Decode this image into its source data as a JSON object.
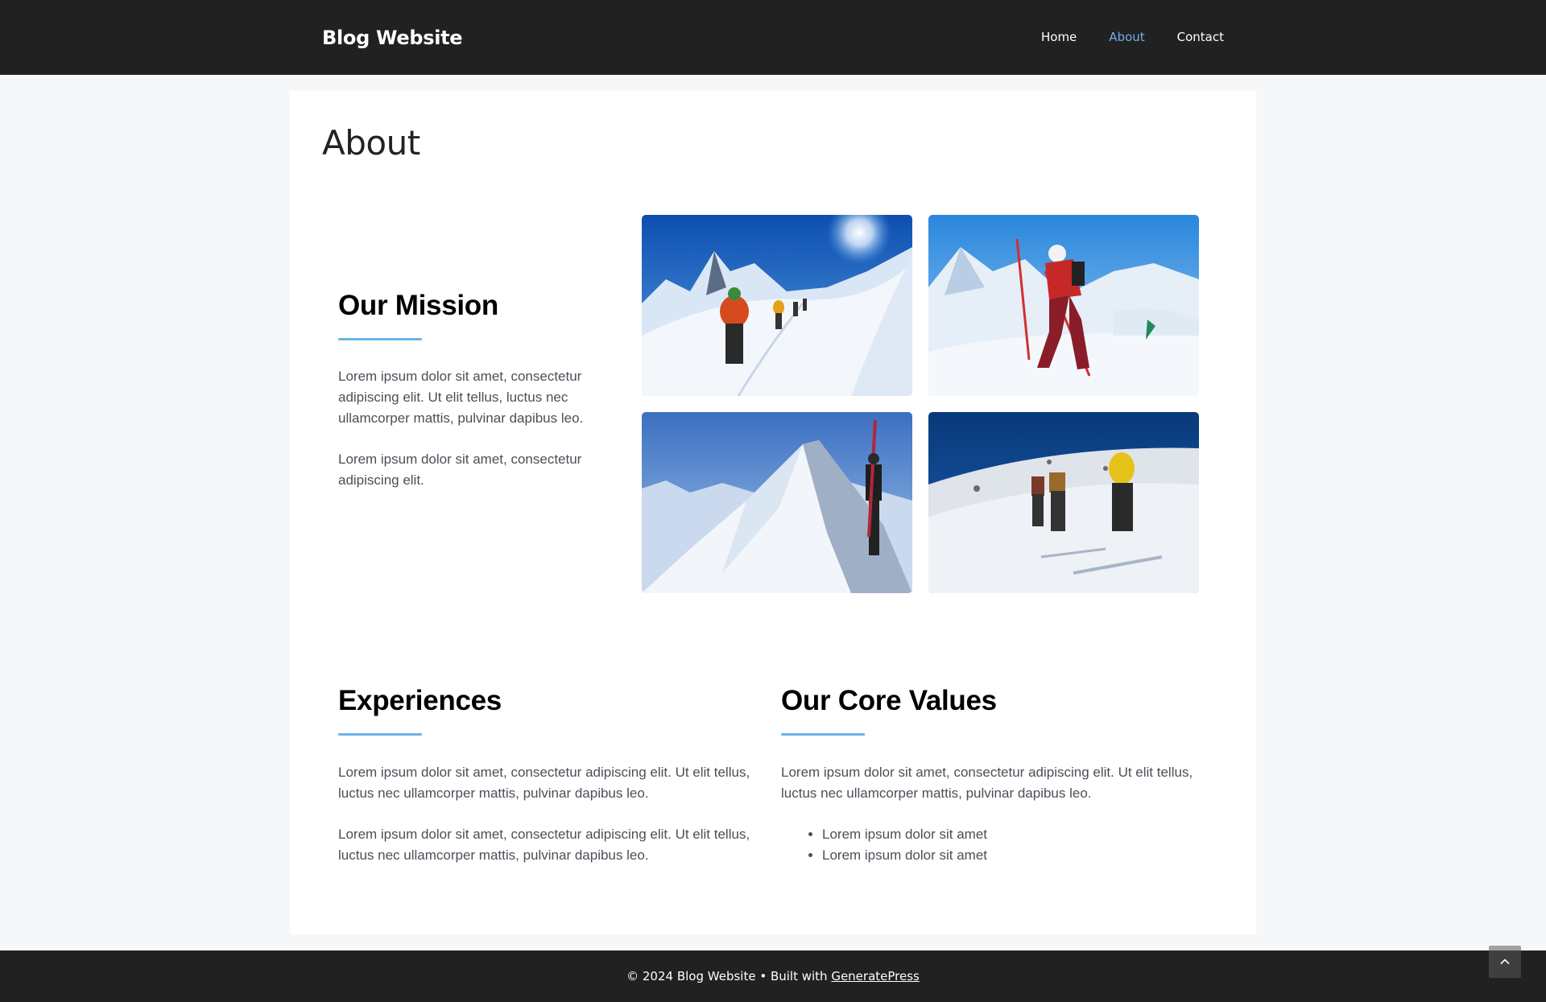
{
  "header": {
    "site_title": "Blog Website",
    "nav": [
      {
        "label": "Home",
        "active": false
      },
      {
        "label": "About",
        "active": true
      },
      {
        "label": "Contact",
        "active": false
      }
    ]
  },
  "page": {
    "title": "About"
  },
  "mission": {
    "heading": "Our Mission",
    "paragraphs": [
      "Lorem ipsum dolor sit amet, consectetur adipiscing elit. Ut elit tellus, luctus nec ullamcorper mattis, pulvinar dapibus leo.",
      "Lorem ipsum dolor sit amet, consectetur adipiscing elit."
    ]
  },
  "gallery": {
    "images": [
      {
        "subject": "ski tourers ascending snowy ridge under bright sun"
      },
      {
        "subject": "ski mountaineer in red climbing with poles"
      },
      {
        "subject": "climber with skis on pack ascending steep snow ridge"
      },
      {
        "subject": "group of ski tourers climbing snow slope"
      }
    ]
  },
  "experiences": {
    "heading": "Experiences",
    "paragraphs": [
      "Lorem ipsum dolor sit amet, consectetur adipiscing elit. Ut elit tellus, luctus nec ullamcorper mattis, pulvinar dapibus leo.",
      "Lorem ipsum dolor sit amet, consectetur adipiscing elit. Ut elit tellus, luctus nec ullamcorper mattis, pulvinar dapibus leo."
    ]
  },
  "core_values": {
    "heading": "Our Core Values",
    "paragraph": "Lorem ipsum dolor sit amet, consectetur adipiscing elit. Ut elit tellus, luctus nec ullamcorper mattis, pulvinar dapibus leo.",
    "list": [
      "Lorem ipsum dolor sit amet",
      "Lorem ipsum dolor sit amet"
    ]
  },
  "footer": {
    "text": "© 2024 Blog Website • Built with ",
    "link": "GeneratePress"
  },
  "colors": {
    "header_bg": "#212121",
    "accent": "#72aee6",
    "underline": "#6ab4e6",
    "page_bg": "#f6f7f9"
  },
  "icons": {
    "back_to_top": "chevron-up-icon"
  }
}
